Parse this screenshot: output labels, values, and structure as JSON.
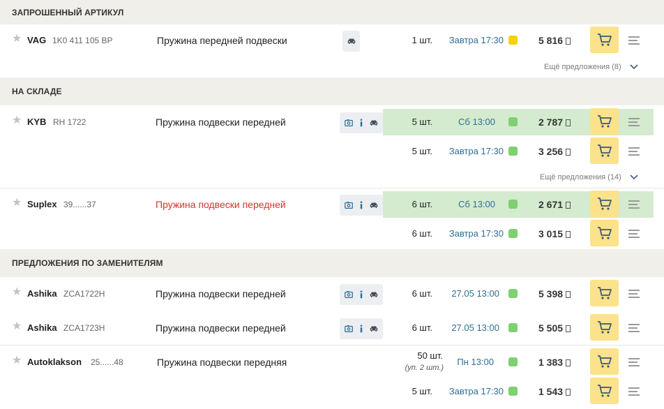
{
  "sections": {
    "requested": "ЗАПРОШЕННЫЙ АРТИКУЛ",
    "stock": "НА СКЛАДЕ",
    "substitutes": "ПРЕДЛОЖЕНИЯ ПО ЗАМЕНИТЕЛЯМ"
  },
  "products": [
    {
      "brand": "VAG",
      "article": "1K0 411 105 BP",
      "description": "Пружина передней подвески",
      "offers": [
        {
          "qty": "1 шт.",
          "time": "Завтра 17:30",
          "price": "5 816",
          "status": "yellow"
        }
      ],
      "more": "Ещё предложения (8)"
    },
    {
      "brand": "KYB",
      "article": "RH 1722",
      "description": "Пружина подвески передней",
      "offers": [
        {
          "qty": "5 шт.",
          "time": "Сб 13:00",
          "price": "2 787",
          "status": "green",
          "highlight": true
        },
        {
          "qty": "5 шт.",
          "time": "Завтра 17:30",
          "price": "3 256",
          "status": "green"
        }
      ],
      "more": "Ещё предложения (14)"
    },
    {
      "brand": "Suplex",
      "article": "39......37",
      "description": "Пружина подвески передней",
      "offers": [
        {
          "qty": "6 шт.",
          "time": "Сб 13:00",
          "price": "2 671",
          "status": "green",
          "highlight": true
        },
        {
          "qty": "6 шт.",
          "time": "Завтра 17:30",
          "price": "3 015",
          "status": "green"
        }
      ]
    },
    {
      "brand": "Ashika",
      "article": "ZCA1722H",
      "description": "Пружина подвески передней",
      "offers": [
        {
          "qty": "6 шт.",
          "time": "27.05 13:00",
          "price": "5 398",
          "status": "green"
        }
      ]
    },
    {
      "brand": "Ashika",
      "article": "ZCA1723H",
      "description": "Пружина подвески передней",
      "offers": [
        {
          "qty": "6 шт.",
          "time": "27.05 13:00",
          "price": "5 505",
          "status": "green"
        }
      ]
    },
    {
      "brand": "Autoklakson",
      "article": "25......48",
      "description": "Пружина подвески передняя",
      "offers": [
        {
          "qty": "50 шт.",
          "pack": "(уп. 2 шт.)",
          "time": "Пн 13:00",
          "price": "1 383",
          "status": "green"
        },
        {
          "qty": "5 шт.",
          "time": "Завтра 17:30",
          "price": "1 543",
          "status": "green"
        }
      ]
    }
  ],
  "colors": {
    "green": "#7ed070",
    "yellow": "#f5d100",
    "highlight": "#d4ebcf",
    "cart": "#fce28a",
    "section": "#f1efe9"
  },
  "icons": {
    "star": "star-icon",
    "car": "car-icon",
    "photo": "photo-icon",
    "info": "info-icon",
    "cart": "cart-icon",
    "menu": "menu-icon",
    "chevron": "chevron-down-icon"
  }
}
